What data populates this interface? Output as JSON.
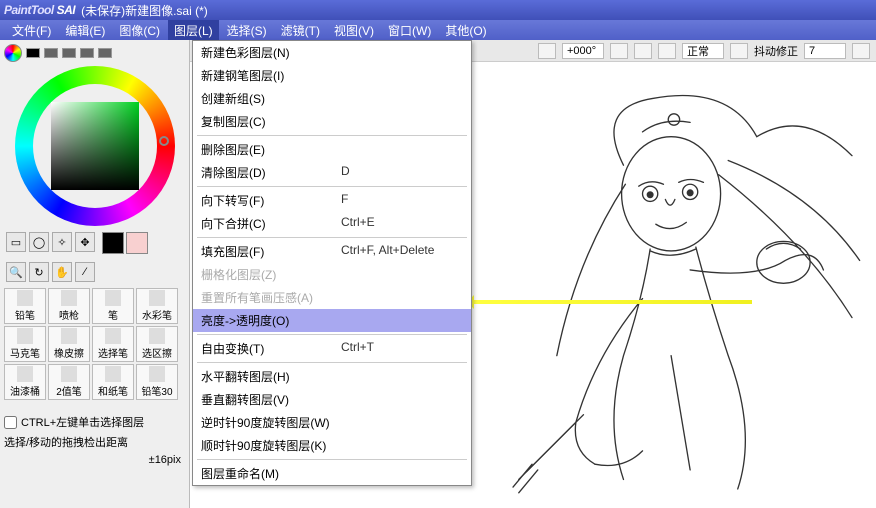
{
  "title": {
    "app": "PaintTool SAI",
    "doc": "(未保存)新建图像.sai (*)"
  },
  "menubar": [
    "文件(F)",
    "编辑(E)",
    "图像(C)",
    "图层(L)",
    "选择(S)",
    "滤镜(T)",
    "视图(V)",
    "窗口(W)",
    "其他(O)"
  ],
  "menubar_active_index": 3,
  "dropdown": {
    "groups": [
      [
        {
          "label": "新建色彩图层(N)",
          "shortcut": "",
          "disabled": false
        },
        {
          "label": "新建钢笔图层(I)",
          "shortcut": "",
          "disabled": false
        },
        {
          "label": "创建新组(S)",
          "shortcut": "",
          "disabled": false
        },
        {
          "label": "复制图层(C)",
          "shortcut": "",
          "disabled": false
        }
      ],
      [
        {
          "label": "删除图层(E)",
          "shortcut": "",
          "disabled": false
        },
        {
          "label": "清除图层(D)",
          "shortcut": "D",
          "disabled": false
        }
      ],
      [
        {
          "label": "向下转写(F)",
          "shortcut": "F",
          "disabled": false
        },
        {
          "label": "向下合拼(C)",
          "shortcut": "Ctrl+E",
          "disabled": false
        }
      ],
      [
        {
          "label": "填充图层(F)",
          "shortcut": "Ctrl+F, Alt+Delete",
          "disabled": false
        },
        {
          "label": "栅格化图层(Z)",
          "shortcut": "",
          "disabled": true
        },
        {
          "label": "重置所有笔画压感(A)",
          "shortcut": "",
          "disabled": true
        },
        {
          "label": "亮度->透明度(O)",
          "shortcut": "",
          "disabled": false,
          "highlight": true
        }
      ],
      [
        {
          "label": "自由变换(T)",
          "shortcut": "Ctrl+T",
          "disabled": false
        }
      ],
      [
        {
          "label": "水平翻转图层(H)",
          "shortcut": "",
          "disabled": false
        },
        {
          "label": "垂直翻转图层(V)",
          "shortcut": "",
          "disabled": false
        },
        {
          "label": "逆时针90度旋转图层(W)",
          "shortcut": "",
          "disabled": false
        },
        {
          "label": "顺时针90度旋转图层(K)",
          "shortcut": "",
          "disabled": false
        }
      ],
      [
        {
          "label": "图层重命名(M)",
          "shortcut": "",
          "disabled": false
        }
      ]
    ]
  },
  "toolbar": {
    "rotation": "+000°",
    "mode": "正常",
    "stabilizer_label": "抖动修正",
    "stabilizer_value": "7"
  },
  "tools": [
    "铅笔",
    "喷枪",
    "笔",
    "水彩笔",
    "马克笔",
    "橡皮擦",
    "选择笔",
    "选区擦",
    "油漆桶",
    "2值笔",
    "和纸笔",
    "铅笔30"
  ],
  "checkbox_label": "CTRL+左键单击选择图层",
  "drag_label": "选择/移动的拖拽检出距离",
  "drag_value": "±16pix"
}
